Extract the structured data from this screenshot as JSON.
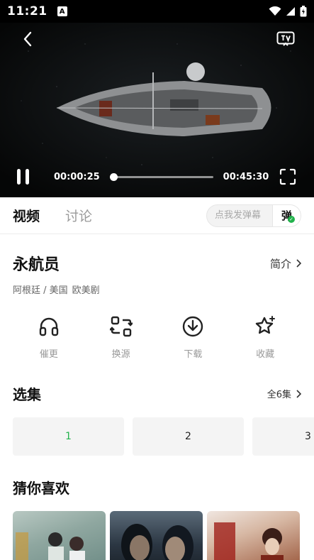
{
  "status_bar": {
    "time": "11:21",
    "notification_badge": "A"
  },
  "player": {
    "current_time": "00:00:25",
    "duration": "00:45:30",
    "progress_fraction": 0.009
  },
  "tabs": [
    {
      "label": "视频",
      "active": true
    },
    {
      "label": "讨论",
      "active": false
    }
  ],
  "danmu": {
    "placeholder": "点我发弹幕",
    "toggle_label": "弹"
  },
  "show": {
    "title": "永航员",
    "intro_label": "简介",
    "meta": [
      "阿根廷 / 美国",
      "欧美剧"
    ]
  },
  "actions": [
    {
      "label": "催更",
      "icon": "headphones-icon"
    },
    {
      "label": "换源",
      "icon": "switch-source-icon"
    },
    {
      "label": "下载",
      "icon": "download-icon"
    },
    {
      "label": "收藏",
      "icon": "star-icon"
    }
  ],
  "episodes": {
    "title": "选集",
    "all_label": "全6集",
    "items": [
      "1",
      "2",
      "3"
    ],
    "current": "1"
  },
  "recommendations": {
    "title": "猜你喜欢"
  },
  "colors": {
    "accent": "#22b24c",
    "player_bg": "#060708"
  }
}
